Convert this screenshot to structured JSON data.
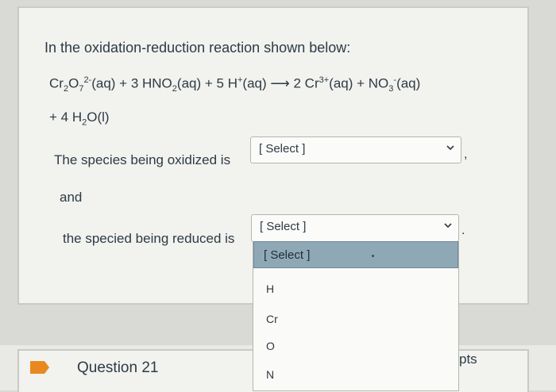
{
  "question": {
    "intro": "In the oxidation-reduction reaction shown below:",
    "equation": {
      "line1": {
        "a": "Cr",
        "s1": "2",
        "b": "O",
        "s2": "7",
        "sup1": "2-",
        "c": "(aq) + 3 HNO",
        "s3": "2",
        "d": "(aq) + 5 H",
        "sup2": "+",
        "e": "(aq)",
        "arrow": "⟶",
        "f": "2 Cr",
        "sup3": "3+",
        "g": "(aq) + NO",
        "s4": "3",
        "sup4": "-",
        "h": "(aq)"
      },
      "line2": {
        "a": "+ 4 H",
        "s1": "2",
        "b": "O(l)"
      }
    },
    "oxidized_label": "The species being oxidized is",
    "and_label": "and",
    "reduced_label": "the specied being reduced is",
    "select1_value": "[ Select ]",
    "select2_value": "[ Select ]",
    "comma": ",",
    "period": "."
  },
  "dropdown": {
    "options": [
      "[ Select ]",
      "H",
      "Cr",
      "O",
      "N"
    ]
  },
  "next_question": {
    "title": "Question 21",
    "points": "pts"
  },
  "colors": {
    "highlight": "#8fa8b6",
    "flag": "#e8891f"
  }
}
